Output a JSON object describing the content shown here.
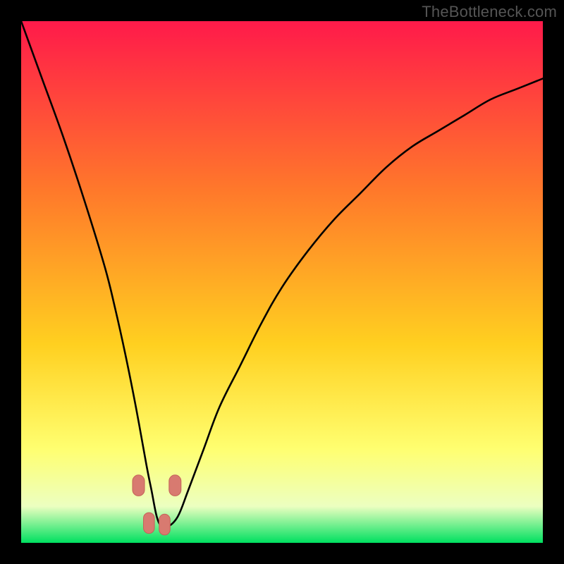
{
  "watermark": "TheBottleneck.com",
  "colors": {
    "page_bg": "#000000",
    "grad_top": "#ff1a4a",
    "grad_mid1": "#ff7a2a",
    "grad_mid2": "#ffd020",
    "grad_low": "#ffff70",
    "grad_pale": "#ecffc0",
    "grad_base": "#00e060",
    "curve": "#000000",
    "marker_fill": "#d87a70",
    "marker_stroke": "#c46258"
  },
  "chart_data": {
    "type": "line",
    "title": "",
    "xlabel": "",
    "ylabel": "",
    "xlim": [
      0,
      100
    ],
    "ylim": [
      0,
      100
    ],
    "legend": false,
    "grid": false,
    "background": "vertical-gradient red→orange→yellow→pale→green, bottleneck heat",
    "series": [
      {
        "name": "bottleneck-curve",
        "x": [
          0,
          4,
          8,
          12,
          16,
          18,
          20,
          22,
          24,
          25,
          26,
          27,
          28,
          30,
          32,
          35,
          38,
          42,
          46,
          50,
          55,
          60,
          65,
          70,
          75,
          80,
          85,
          90,
          95,
          100
        ],
        "y": [
          100,
          89,
          78,
          66,
          53,
          45,
          36,
          26,
          15,
          10,
          5,
          3,
          3,
          5,
          10,
          18,
          26,
          34,
          42,
          49,
          56,
          62,
          67,
          72,
          76,
          79,
          82,
          85,
          87,
          89
        ]
      }
    ],
    "markers": [
      {
        "x": 22.5,
        "y": 11,
        "w": 2.3,
        "h": 4
      },
      {
        "x": 24.5,
        "y": 3.8,
        "w": 2.1,
        "h": 4
      },
      {
        "x": 27.5,
        "y": 3.5,
        "w": 2.1,
        "h": 4
      },
      {
        "x": 29.5,
        "y": 11,
        "w": 2.3,
        "h": 4
      }
    ],
    "notch": {
      "x": 26,
      "depth": 0
    },
    "description": "V-shaped bottleneck curve; minimum (~0%) near x≈26 of 100; right arm asymptotes toward ~89%."
  }
}
